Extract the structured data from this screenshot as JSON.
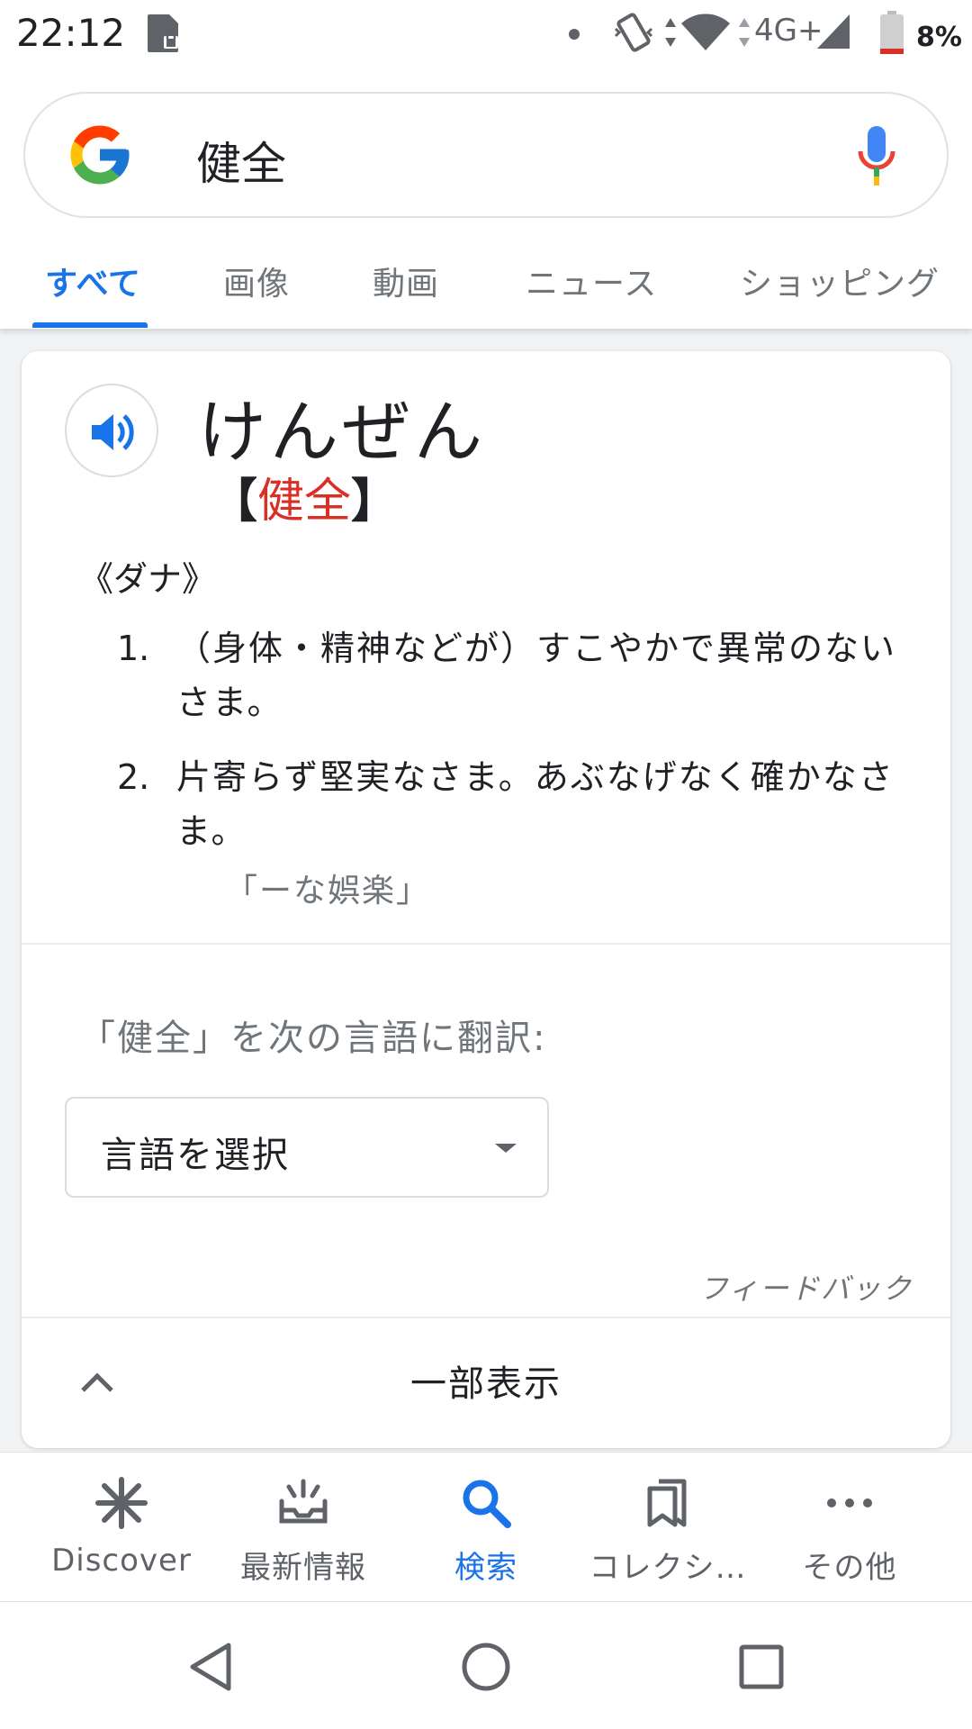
{
  "status_bar": {
    "time": "22:12",
    "network": "4G+",
    "battery": "8%"
  },
  "search": {
    "query": "健全"
  },
  "tabs": [
    {
      "label": "すべて",
      "active": true
    },
    {
      "label": "画像",
      "active": false
    },
    {
      "label": "動画",
      "active": false
    },
    {
      "label": "ニュース",
      "active": false
    },
    {
      "label": "ショッピング",
      "active": false
    }
  ],
  "dictionary": {
    "reading": "けんぜん",
    "bracket_open": "【",
    "kanji": "健全",
    "bracket_close": "】",
    "part_of_speech": "《ダナ》",
    "definitions": [
      {
        "number": "1.",
        "text": "（身体・精神などが）すこやかで異常のないさま。"
      },
      {
        "number": "2.",
        "text": "片寄らず堅実なさま。あぶなげなく確かなさま。"
      }
    ],
    "example": "「ーな娯楽」"
  },
  "translate": {
    "label": "「健全」を次の言語に翻訳:",
    "select_value": "言語を選択"
  },
  "feedback_label": "フィードバック",
  "collapse_label": "一部表示",
  "bottom_nav": [
    {
      "label": "Discover",
      "icon": "asterisk-icon",
      "active": false
    },
    {
      "label": "最新情報",
      "icon": "updates-icon",
      "active": false
    },
    {
      "label": "検索",
      "icon": "search-icon",
      "active": true
    },
    {
      "label": "コレクシ…",
      "icon": "collections-icon",
      "active": false
    },
    {
      "label": "その他",
      "icon": "more-icon",
      "active": false
    }
  ],
  "colors": {
    "accent_blue": "#1a73e8",
    "kanji_red": "#d93025",
    "text_primary": "#202124",
    "text_secondary": "#70757a"
  }
}
